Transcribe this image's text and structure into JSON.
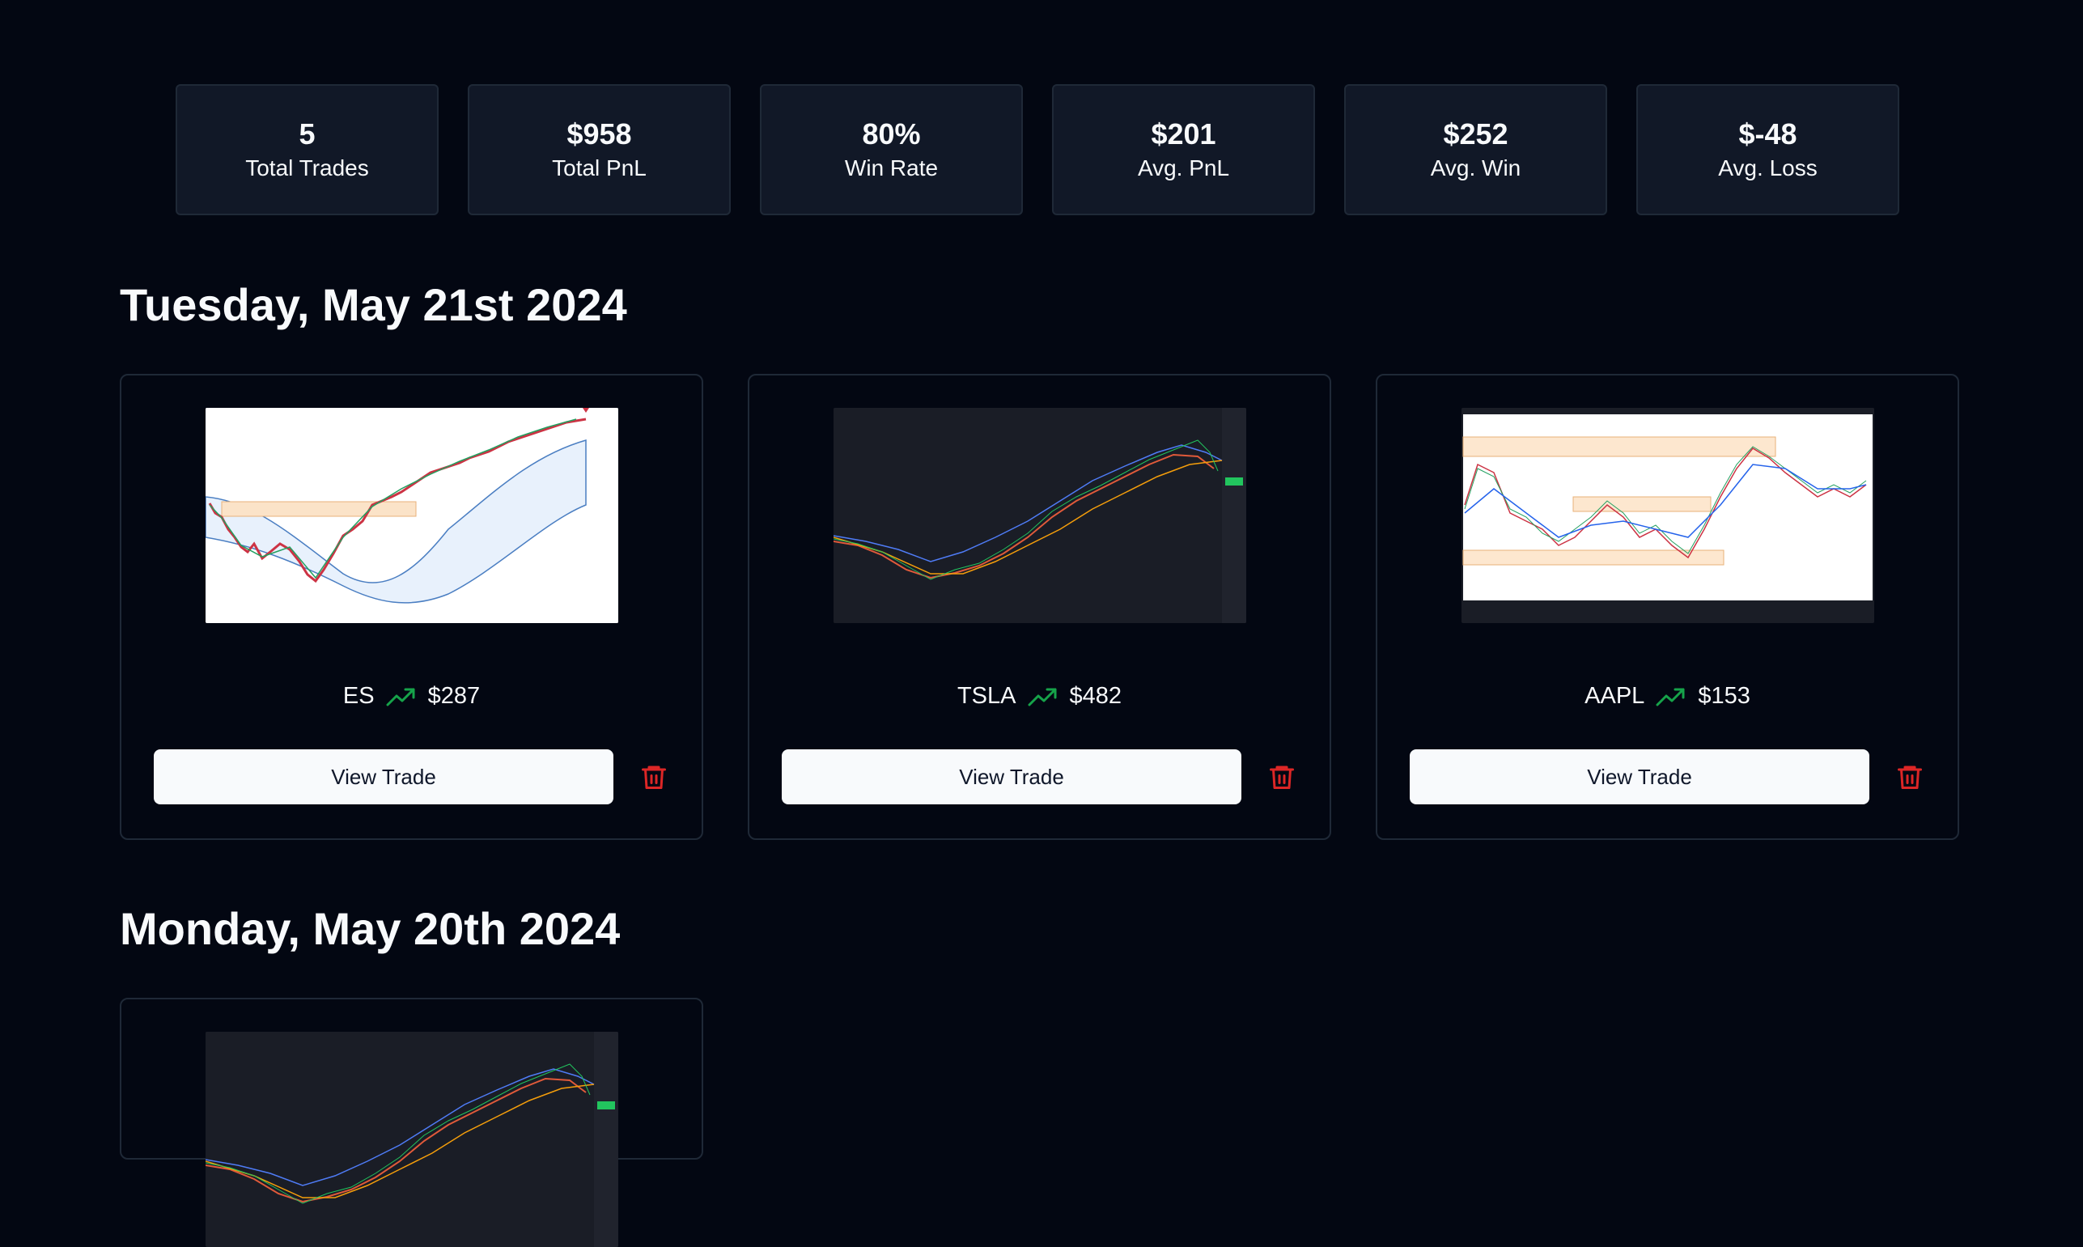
{
  "stats": [
    {
      "value": "5",
      "label": "Total Trades"
    },
    {
      "value": "$958",
      "label": "Total PnL"
    },
    {
      "value": "80%",
      "label": "Win Rate"
    },
    {
      "value": "$201",
      "label": "Avg. PnL"
    },
    {
      "value": "$252",
      "label": "Avg. Win"
    },
    {
      "value": "$-48",
      "label": "Avg. Loss"
    }
  ],
  "days": [
    {
      "heading": "Tuesday, May 21st 2024",
      "trades": [
        {
          "symbol": "ES",
          "pnl": "$287",
          "view_label": "View Trade",
          "thumbnail": "light-bollinger-chart"
        },
        {
          "symbol": "TSLA",
          "pnl": "$482",
          "view_label": "View Trade",
          "thumbnail": "dark-candlestick-chart"
        },
        {
          "symbol": "AAPL",
          "pnl": "$153",
          "view_label": "View Trade",
          "thumbnail": "light-zones-chart"
        }
      ]
    },
    {
      "heading": "Monday, May 20th 2024",
      "trades": [
        {
          "thumbnail": "dark-candlestick-chart"
        }
      ]
    }
  ],
  "colors": {
    "background": "#030712",
    "card_border": "#1f2937",
    "stat_background": "#111827",
    "trend_up": "#16a34a",
    "delete": "#dc2626"
  },
  "icons": {
    "trend": "trending-up-icon",
    "delete": "trash-icon"
  }
}
